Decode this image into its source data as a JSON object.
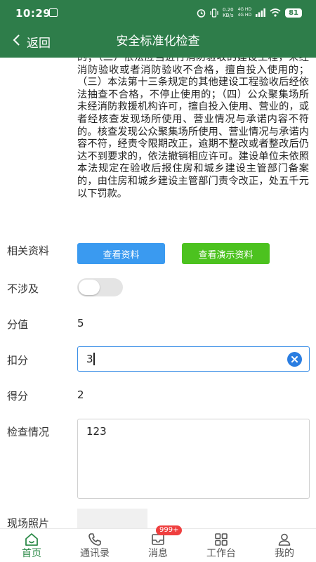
{
  "status_bar": {
    "time": "10:29",
    "speed_value": "0.20",
    "speed_unit": "KB/s",
    "network_labels": [
      "4G HD",
      "4G HD"
    ],
    "battery": "81"
  },
  "header": {
    "back_label": "返回",
    "title": "安全标准化检查"
  },
  "content": {
    "law_text": "的；（二）依法应当进行消防验收的建设工程，未经消防验收或者消防验收不合格，擅自投入使用的；（三）本法第十三条规定的其他建设工程验收后经依法抽查不合格，不停止使用的；（四）公众聚集场所未经消防救援机构许可，擅自投入使用、营业的，或者经核查发现场所使用、营业情况与承诺内容不符的。核查发现公众聚集场所使用、营业情况与承诺内容不符，经责令限期改正，逾期不整改或者整改后仍达不到要求的，依法撤销相应许可。建设单位未依照本法规定在验收后报住房和城乡建设主管部门备案的，由住房和城乡建设主管部门责令改正，处五千元以下罚款。",
    "related_label": "相关资料",
    "view_material_button": "查看资料",
    "view_demo_button": "查看演示资料",
    "not_applicable_label": "不涉及",
    "not_applicable_on": false,
    "score_label": "分值",
    "score_value": "5",
    "deduction_label": "扣分",
    "deduction_value": "3",
    "earned_label": "得分",
    "earned_value": "2",
    "inspection_label": "检查情况",
    "inspection_value": "123",
    "photo_label": "现场照片"
  },
  "bottom_nav": {
    "items": [
      {
        "label": "首页",
        "icon": "home-icon",
        "active": true
      },
      {
        "label": "通讯录",
        "icon": "phone-icon",
        "active": false
      },
      {
        "label": "消息",
        "icon": "message-icon",
        "active": false,
        "badge": "999+"
      },
      {
        "label": "工作台",
        "icon": "grid-icon",
        "active": false
      },
      {
        "label": "我的",
        "icon": "user-icon",
        "active": false
      }
    ]
  },
  "colors": {
    "brand_green": "#2e7d4a",
    "button_blue": "#3a9af0",
    "button_green": "#4cc21f",
    "badge_red": "#ef3f3f"
  }
}
